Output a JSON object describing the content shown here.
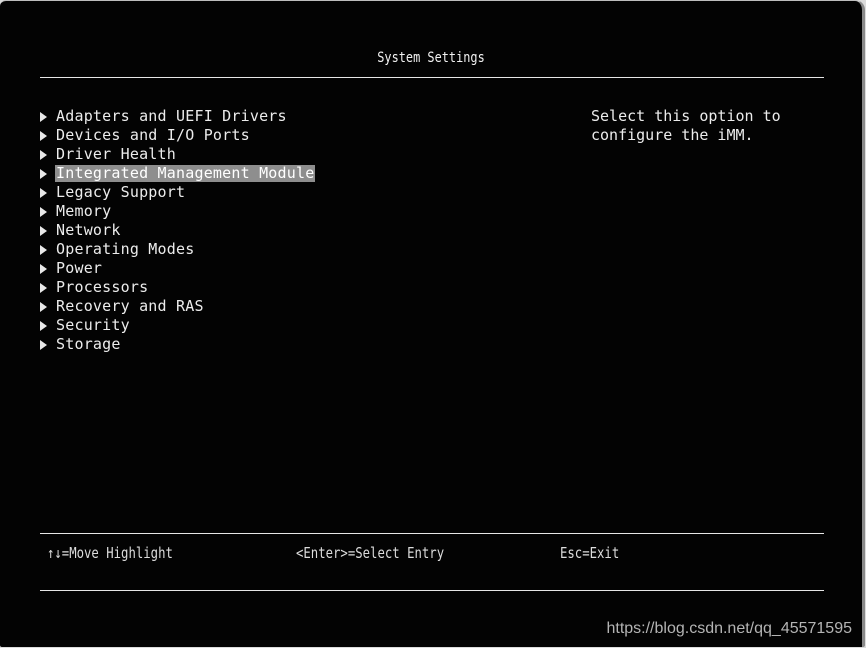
{
  "header": {
    "title": "System Settings"
  },
  "menu": {
    "selected_index": 3,
    "items": [
      {
        "label": "Adapters and UEFI Drivers",
        "icon": "submenu-arrow-icon"
      },
      {
        "label": "Devices and I/O Ports",
        "icon": "submenu-arrow-icon"
      },
      {
        "label": "Driver Health",
        "icon": "submenu-arrow-icon"
      },
      {
        "label": "Integrated Management Module",
        "icon": "submenu-arrow-icon"
      },
      {
        "label": "Legacy Support",
        "icon": "submenu-arrow-icon"
      },
      {
        "label": "Memory",
        "icon": "submenu-arrow-icon"
      },
      {
        "label": "Network",
        "icon": "submenu-arrow-icon"
      },
      {
        "label": "Operating Modes",
        "icon": "submenu-arrow-icon"
      },
      {
        "label": "Power",
        "icon": "submenu-arrow-icon"
      },
      {
        "label": "Processors",
        "icon": "submenu-arrow-icon"
      },
      {
        "label": "Recovery and RAS",
        "icon": "submenu-arrow-icon"
      },
      {
        "label": "Security",
        "icon": "submenu-arrow-icon"
      },
      {
        "label": "Storage",
        "icon": "submenu-arrow-icon"
      }
    ]
  },
  "help": {
    "text": "Select this option to\nconfigure the iMM."
  },
  "footer": {
    "move": "↑↓=Move Highlight",
    "select": "<Enter>=Select Entry",
    "exit": "Esc=Exit"
  },
  "watermark": {
    "text": "https://blog.csdn.net/qq_45571595"
  },
  "colors": {
    "background": "#030303",
    "text": "#ececec",
    "highlight": "#8e8e8e"
  }
}
